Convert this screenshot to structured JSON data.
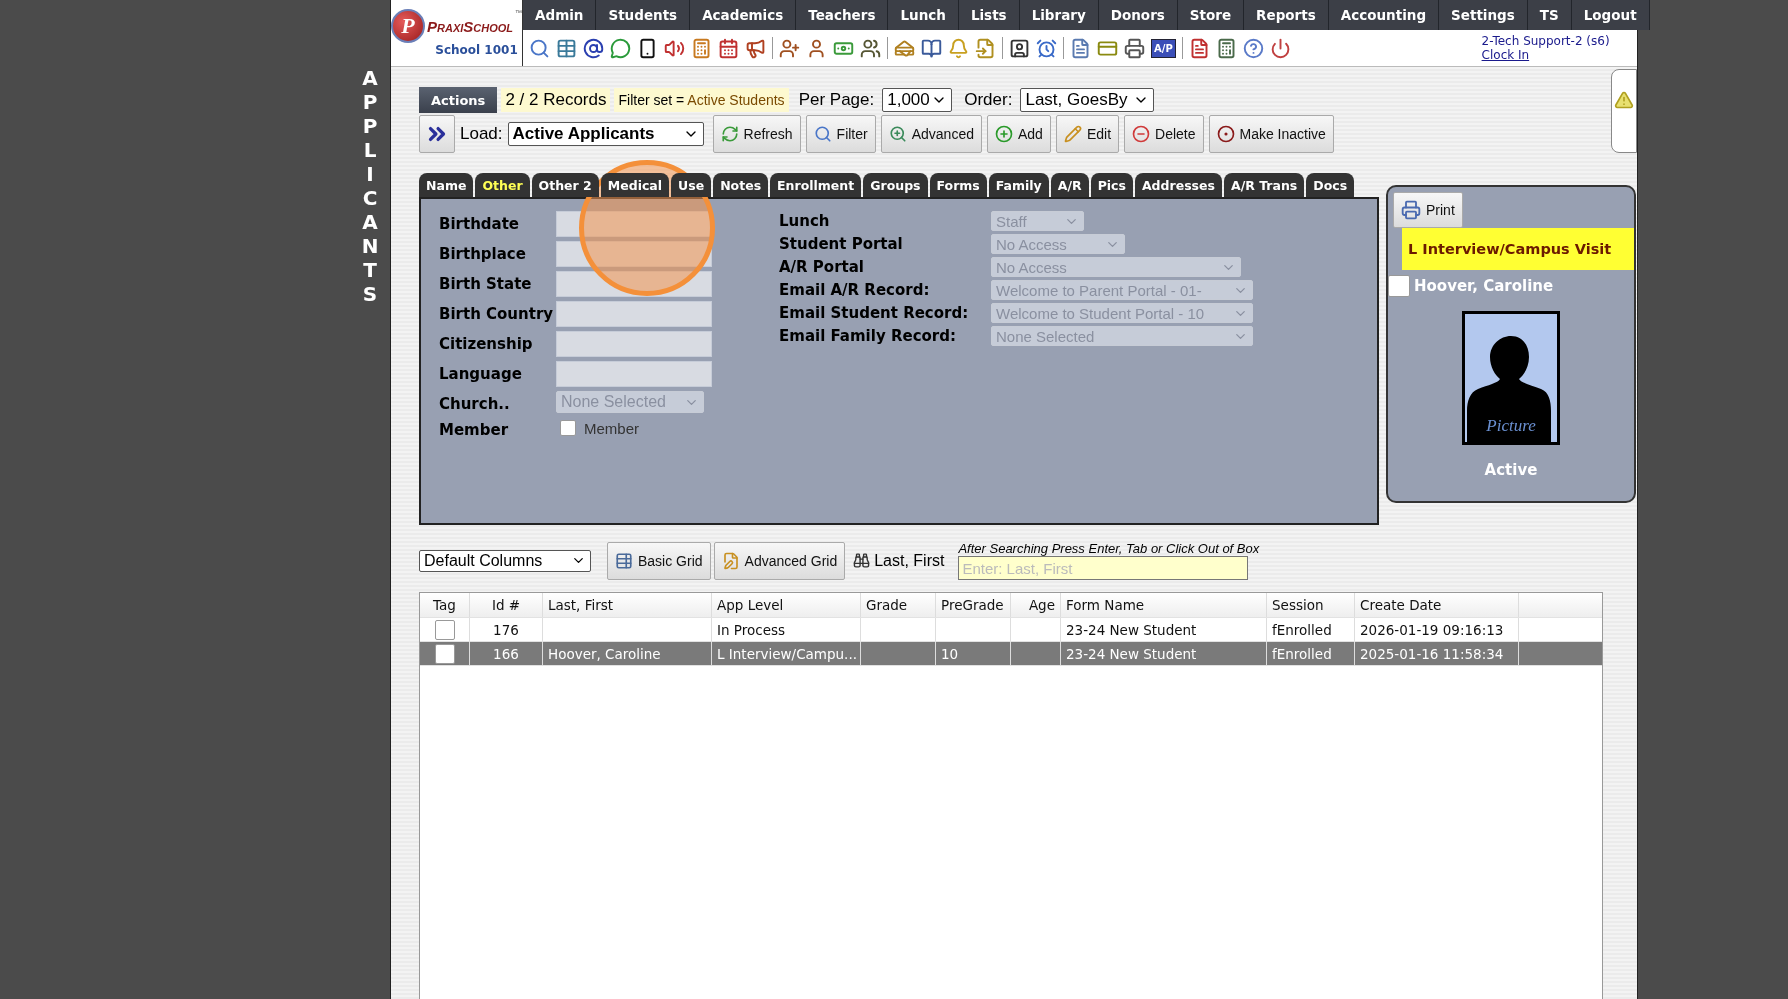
{
  "side_title": "APPLICANTS",
  "logo": {
    "mark": "P",
    "name": "PraxiSchool",
    "tm": "™",
    "school": "School 1001"
  },
  "nav": [
    "Admin",
    "Students",
    "Academics",
    "Teachers",
    "Lunch",
    "Lists",
    "Library",
    "Donors",
    "Store",
    "Reports",
    "Accounting",
    "Settings",
    "TS",
    "Logout"
  ],
  "toolbar": {
    "badge": "A/P"
  },
  "user": {
    "name": "2-Tech Support-2 (s6)",
    "link": "Clock In"
  },
  "actions": {
    "label": "Actions",
    "records": "2 / 2 Records",
    "filter_label": "Filter set = ",
    "filter_value": "Active Students",
    "per_page_label": "Per Page:",
    "per_page": "1,000",
    "order_label": "Order:",
    "order": "Last, GoesBy"
  },
  "load": {
    "label": "Load:",
    "value": "Active Applicants"
  },
  "buttons": [
    "Refresh",
    "Filter",
    "Advanced",
    "Add",
    "Edit",
    "Delete",
    "Make Inactive"
  ],
  "tabs": [
    {
      "label": "Name",
      "selected": false
    },
    {
      "label": "Other",
      "selected": true
    },
    {
      "label": "Other 2",
      "selected": false
    },
    {
      "label": "Medical",
      "selected": false
    },
    {
      "label": "Use",
      "selected": false
    },
    {
      "label": "Notes",
      "selected": false
    },
    {
      "label": "Enrollment",
      "selected": false
    },
    {
      "label": "Groups",
      "selected": false
    },
    {
      "label": "Forms",
      "selected": false
    },
    {
      "label": "Family",
      "selected": false
    },
    {
      "label": "A/R",
      "selected": false
    },
    {
      "label": "Pics",
      "selected": false
    },
    {
      "label": "Addresses",
      "selected": false
    },
    {
      "label": "A/R Trans",
      "selected": false
    },
    {
      "label": "Docs",
      "selected": false
    }
  ],
  "form": {
    "left": [
      {
        "label": "Birthdate",
        "kind": "text"
      },
      {
        "label": "Birthplace",
        "kind": "text"
      },
      {
        "label": "Birth State",
        "kind": "text"
      },
      {
        "label": "Birth Country",
        "kind": "text"
      },
      {
        "label": "Citizenship",
        "kind": "text"
      },
      {
        "label": "Language",
        "kind": "text"
      },
      {
        "label": "Church..",
        "kind": "select",
        "value": "None Selected",
        "disabled": true
      },
      {
        "label": "Member",
        "kind": "checkbox",
        "caption": "Member",
        "checked": false
      }
    ],
    "right": [
      {
        "label": "Lunch",
        "value": "Staff",
        "disabled": true
      },
      {
        "label": "Student Portal",
        "value": "No Access",
        "disabled": true
      },
      {
        "label": "A/R Portal",
        "value": "No Access",
        "disabled": true
      },
      {
        "label": "Email A/R Record:",
        "value": "Welcome to Parent Portal - 01-",
        "disabled": true
      },
      {
        "label": "Email Student Record:",
        "value": "Welcome to Student Portal - 10",
        "disabled": true
      },
      {
        "label": "Email Family Record:",
        "value": "None Selected",
        "disabled": true
      }
    ]
  },
  "card": {
    "print": "Print",
    "status": "L Interview/Campus Visit",
    "name": "Hoover, Caroline",
    "checked": false,
    "photo_caption": "Picture",
    "state": "Active"
  },
  "grid_tools": {
    "columns": "Default Columns",
    "buttons": [
      "Basic Grid",
      "Advanced Grid"
    ],
    "search_label": "Last, First",
    "hint": "After Searching Press Enter, Tab or Click Out of Box",
    "placeholder": "Enter: Last, First"
  },
  "table": {
    "columns": [
      "Tag",
      "Id #",
      "Last, First",
      "App Level",
      "Grade",
      "PreGrade",
      "Age",
      "Form Name",
      "Session",
      "Create Date"
    ],
    "rows": [
      {
        "selected": false,
        "checked": false,
        "cells": [
          "",
          "176",
          "",
          "In Process",
          "",
          "",
          "",
          "23-24 New Student",
          "fEnrolled",
          "2026-01-19 09:16:13"
        ]
      },
      {
        "selected": true,
        "checked": false,
        "cells": [
          "",
          "166",
          "Hoover, Caroline",
          "L Interview/Campu...",
          "",
          "10",
          "",
          "23-24 New Student",
          "fEnrolled",
          "2025-01-16 11:58:34"
        ]
      }
    ]
  }
}
